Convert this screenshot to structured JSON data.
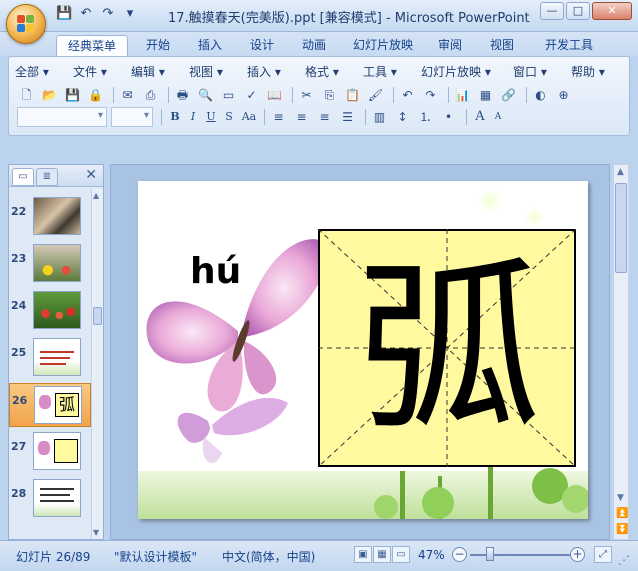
{
  "window": {
    "title": "17.触摸春天(完美版).ppt [兼容模式] - Microsoft PowerPoint",
    "controls": {
      "minimize": "—",
      "maximize": "□",
      "close": "✕"
    }
  },
  "quick_access": {
    "save": "💾",
    "undo": "↶",
    "redo": "↷",
    "more": "▾"
  },
  "ribbon_tabs": [
    {
      "label": "经典菜单",
      "active": true
    },
    {
      "label": "开始"
    },
    {
      "label": "插入"
    },
    {
      "label": "设计"
    },
    {
      "label": "动画"
    },
    {
      "label": "幻灯片放映"
    },
    {
      "label": "审阅"
    },
    {
      "label": "视图"
    },
    {
      "label": "开发工具"
    }
  ],
  "classic_menu": [
    "全部 ▾",
    "文件 ▾",
    "编辑 ▾",
    "视图 ▾",
    "插入 ▾",
    "格式 ▾",
    "工具 ▾",
    "幻灯片放映 ▾",
    "窗口 ▾",
    "帮助 ▾"
  ],
  "format_buttons": {
    "bold": "B",
    "italic": "I",
    "underline": "U",
    "shadow": "S",
    "change_case": "Aa",
    "grow": "A",
    "shrink": "A"
  },
  "slide_thumbnails": [
    {
      "num": "22"
    },
    {
      "num": "23"
    },
    {
      "num": "24"
    },
    {
      "num": "25"
    },
    {
      "num": "26",
      "selected": true
    },
    {
      "num": "27"
    },
    {
      "num": "28"
    }
  ],
  "slide": {
    "pinyin": "hú",
    "character": "弧"
  },
  "status_bar": {
    "slide_info": "幻灯片 26/89",
    "template": "\"默认设计模板\"",
    "language": "中文(简体，中国)",
    "zoom": "47%",
    "zoom_out": "−",
    "zoom_in": "+"
  },
  "colors": {
    "accent": "#15428b",
    "selected_thumb": "#f3a34a",
    "tian_grid": "#fffaa0"
  }
}
